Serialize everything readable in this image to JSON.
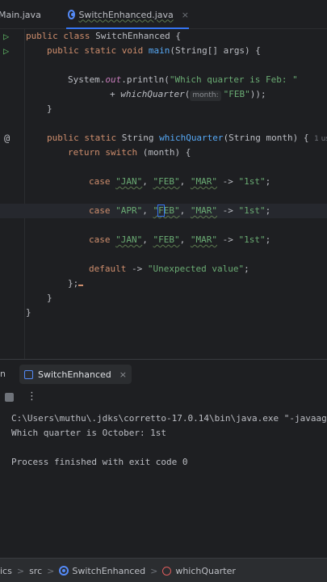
{
  "tabs": {
    "main": "Main.java",
    "active": "SwitchEnhanced.java",
    "close": "×"
  },
  "code": {
    "l1": {
      "kw": "public class ",
      "name": "SwitchEnhanced {"
    },
    "l2": {
      "kw": "public static void ",
      "fn": "main",
      "rest": "(String[] args) {"
    },
    "l4": {
      "a": "System.",
      "field": "out",
      "b": ".println(",
      "str": "\"Which quarter is Feb: \""
    },
    "l5": {
      "plus": "+ ",
      "fn": "whichQuarter",
      "paren": "(",
      "hint": "month:",
      "str": "\"FEB\"",
      "end": "));"
    },
    "l6": "}",
    "l8": {
      "kw": "public static ",
      "type": "String ",
      "fn": "whichQuarter",
      "rest": "(String month) {",
      "usages": "1 us"
    },
    "l9": {
      "kw": "return switch ",
      "rest": "(month) {"
    },
    "case1": {
      "kw": "case ",
      "s1": "\"JAN\"",
      "s2": "\"FEB\"",
      "s3": "\"MAR\"",
      "arrow": " -> ",
      "res": "\"1st\"",
      "semi": ";"
    },
    "case2": {
      "kw": "case ",
      "s1": "\"APR\"",
      "s2a": "\"",
      "s2b": "F",
      "s2c": "EB\"",
      "s3": "\"MAR\"",
      "arrow": " -> ",
      "res": "\"1st\"",
      "semi": ";"
    },
    "case3": {
      "kw": "case ",
      "s1": "\"JAN\"",
      "s2": "\"FEB\"",
      "s3": "\"MAR\"",
      "arrow": " -> ",
      "res": "\"1st\"",
      "semi": ";"
    },
    "default": {
      "kw": "default",
      "arrow": " -> ",
      "str": "\"Unexpected value\"",
      "semi": ";"
    },
    "close_switch": "};",
    "close_method": "}",
    "close_class": "}",
    "comma": ", "
  },
  "run_panel": {
    "label": "n",
    "tab": "SwitchEnhanced",
    "close": "×",
    "more": "⋮"
  },
  "console": {
    "cmd": "C:\\Users\\muthu\\.jdks\\corretto-17.0.14\\bin\\java.exe \"-javaage",
    "out": "Which quarter is October: 1st",
    "exit": "Process finished with exit code 0"
  },
  "status": {
    "c1": "ics",
    "c2": "src",
    "c3": "SwitchEnhanced",
    "c4": "whichQuarter",
    "sep": ">"
  }
}
